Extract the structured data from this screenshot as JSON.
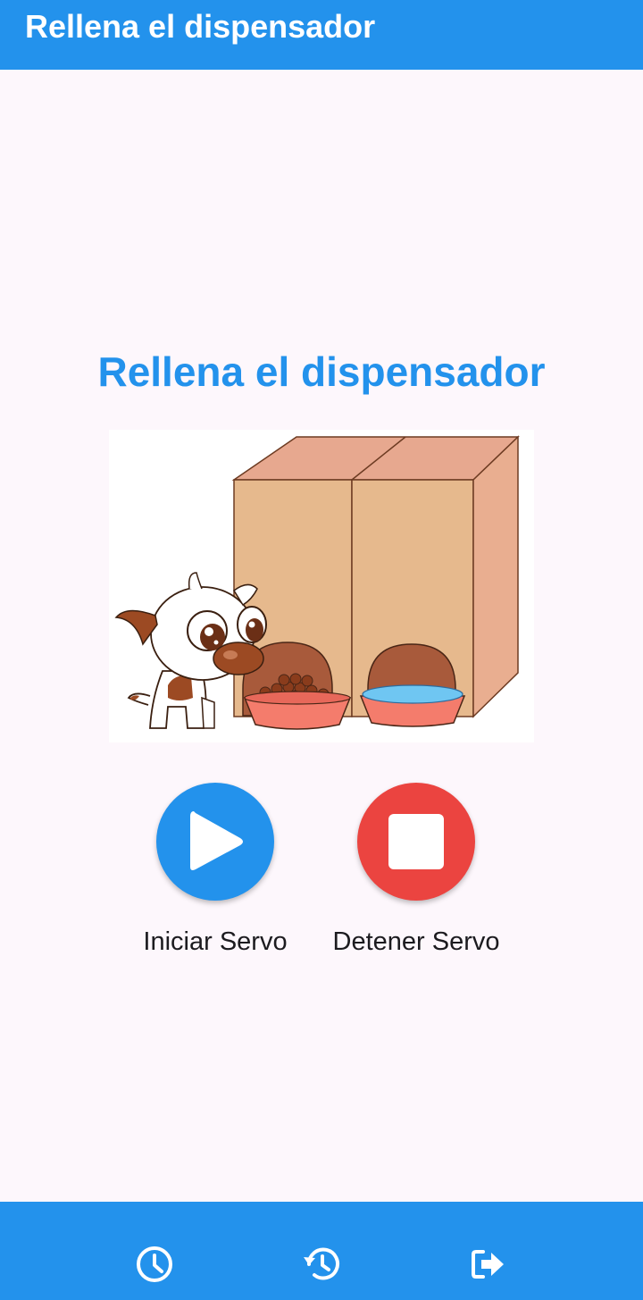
{
  "app_bar": {
    "title": "Rellena el dispensador"
  },
  "main": {
    "heading": "Rellena el dispensador",
    "illustration": {
      "icon": "dog-food-dispenser-illustration"
    },
    "actions": [
      {
        "label": "Iniciar Servo",
        "icon": "play-icon",
        "color": "#2392ec"
      },
      {
        "label": "Detener Servo",
        "icon": "stop-icon",
        "color": "#eb4440"
      }
    ]
  },
  "bottom_nav": {
    "items": [
      {
        "icon": "clock-icon"
      },
      {
        "icon": "history-icon"
      },
      {
        "icon": "logout-icon"
      }
    ]
  },
  "colors": {
    "primary": "#2392ec",
    "danger": "#eb4440",
    "background": "#fdf7fc"
  }
}
